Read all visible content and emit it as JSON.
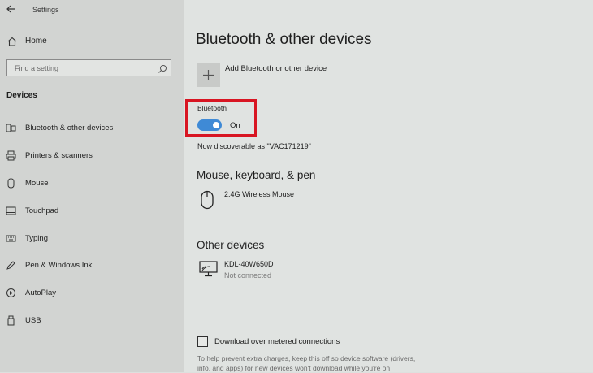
{
  "window": {
    "title": "Settings"
  },
  "sidebar": {
    "home_label": "Home",
    "search_placeholder": "Find a setting",
    "section_heading": "Devices",
    "items": [
      {
        "label": "Bluetooth & other devices",
        "icon": "bluetooth-devices-icon"
      },
      {
        "label": "Printers & scanners",
        "icon": "printer-icon"
      },
      {
        "label": "Mouse",
        "icon": "mouse-icon"
      },
      {
        "label": "Touchpad",
        "icon": "touchpad-icon"
      },
      {
        "label": "Typing",
        "icon": "keyboard-icon"
      },
      {
        "label": "Pen & Windows Ink",
        "icon": "pen-icon"
      },
      {
        "label": "AutoPlay",
        "icon": "autoplay-icon"
      },
      {
        "label": "USB",
        "icon": "usb-icon"
      }
    ]
  },
  "main": {
    "title": "Bluetooth & other devices",
    "add_device_label": "Add Bluetooth or other device",
    "bluetooth": {
      "label": "Bluetooth",
      "toggle_state": "On",
      "discoverable_text": "Now discoverable as \"VAC171219\""
    },
    "mouse_section": {
      "heading": "Mouse, keyboard, & pen",
      "devices": [
        {
          "name": "2.4G Wireless Mouse",
          "icon": "mouse-device-icon"
        }
      ]
    },
    "other_section": {
      "heading": "Other devices",
      "devices": [
        {
          "name": "KDL-40W650D",
          "status": "Not connected",
          "icon": "display-device-icon"
        }
      ]
    },
    "metered": {
      "label": "Download over metered connections",
      "help_line1": "To help prevent extra charges, keep this off so device software (drivers,",
      "help_line2": "info, and apps) for new devices won't download while you're on"
    }
  },
  "colors": {
    "accent": "#3f8ad6",
    "highlight_box": "#d81522",
    "sidebar_bg": "#d2d4d2",
    "main_bg": "#e0e3e1"
  }
}
